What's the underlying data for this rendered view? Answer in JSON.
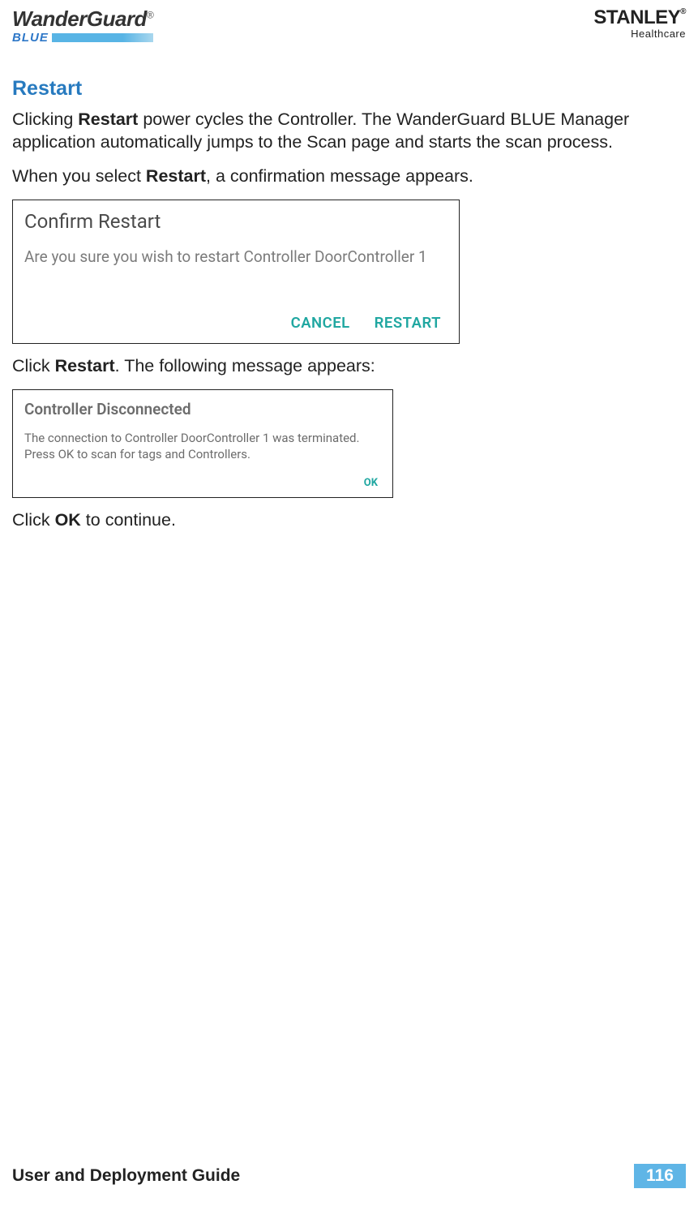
{
  "header": {
    "brand_main": "WanderGuard",
    "brand_reg": "®",
    "brand_sub": "BLUE",
    "company_main": "STANLEY",
    "company_reg": "®",
    "company_sub": "Healthcare"
  },
  "section": {
    "heading": "Restart",
    "para1_pre": "Clicking ",
    "para1_bold": "Restart",
    "para1_post": " power cycles the Controller. The WanderGuard BLUE Manager application automatically jumps to the Scan page and starts the scan process.",
    "para2_pre": "When you select ",
    "para2_bold": "Restart",
    "para2_post": ", a confirmation message appears.",
    "para3_pre": "Click ",
    "para3_bold": "Restart",
    "para3_post": ". The following message appears:",
    "para4_pre": "Click ",
    "para4_bold": "OK",
    "para4_post": " to continue."
  },
  "dialog1": {
    "title": "Confirm Restart",
    "body": "Are you sure you wish to restart Controller DoorController 1",
    "cancel": "CANCEL",
    "restart": "RESTART"
  },
  "dialog2": {
    "title": "Controller Disconnected",
    "body": "The connection to Controller DoorController 1 was terminated. Press OK to scan for tags and Controllers.",
    "ok": "OK"
  },
  "footer": {
    "guide": "User and Deployment Guide",
    "page": "116"
  }
}
